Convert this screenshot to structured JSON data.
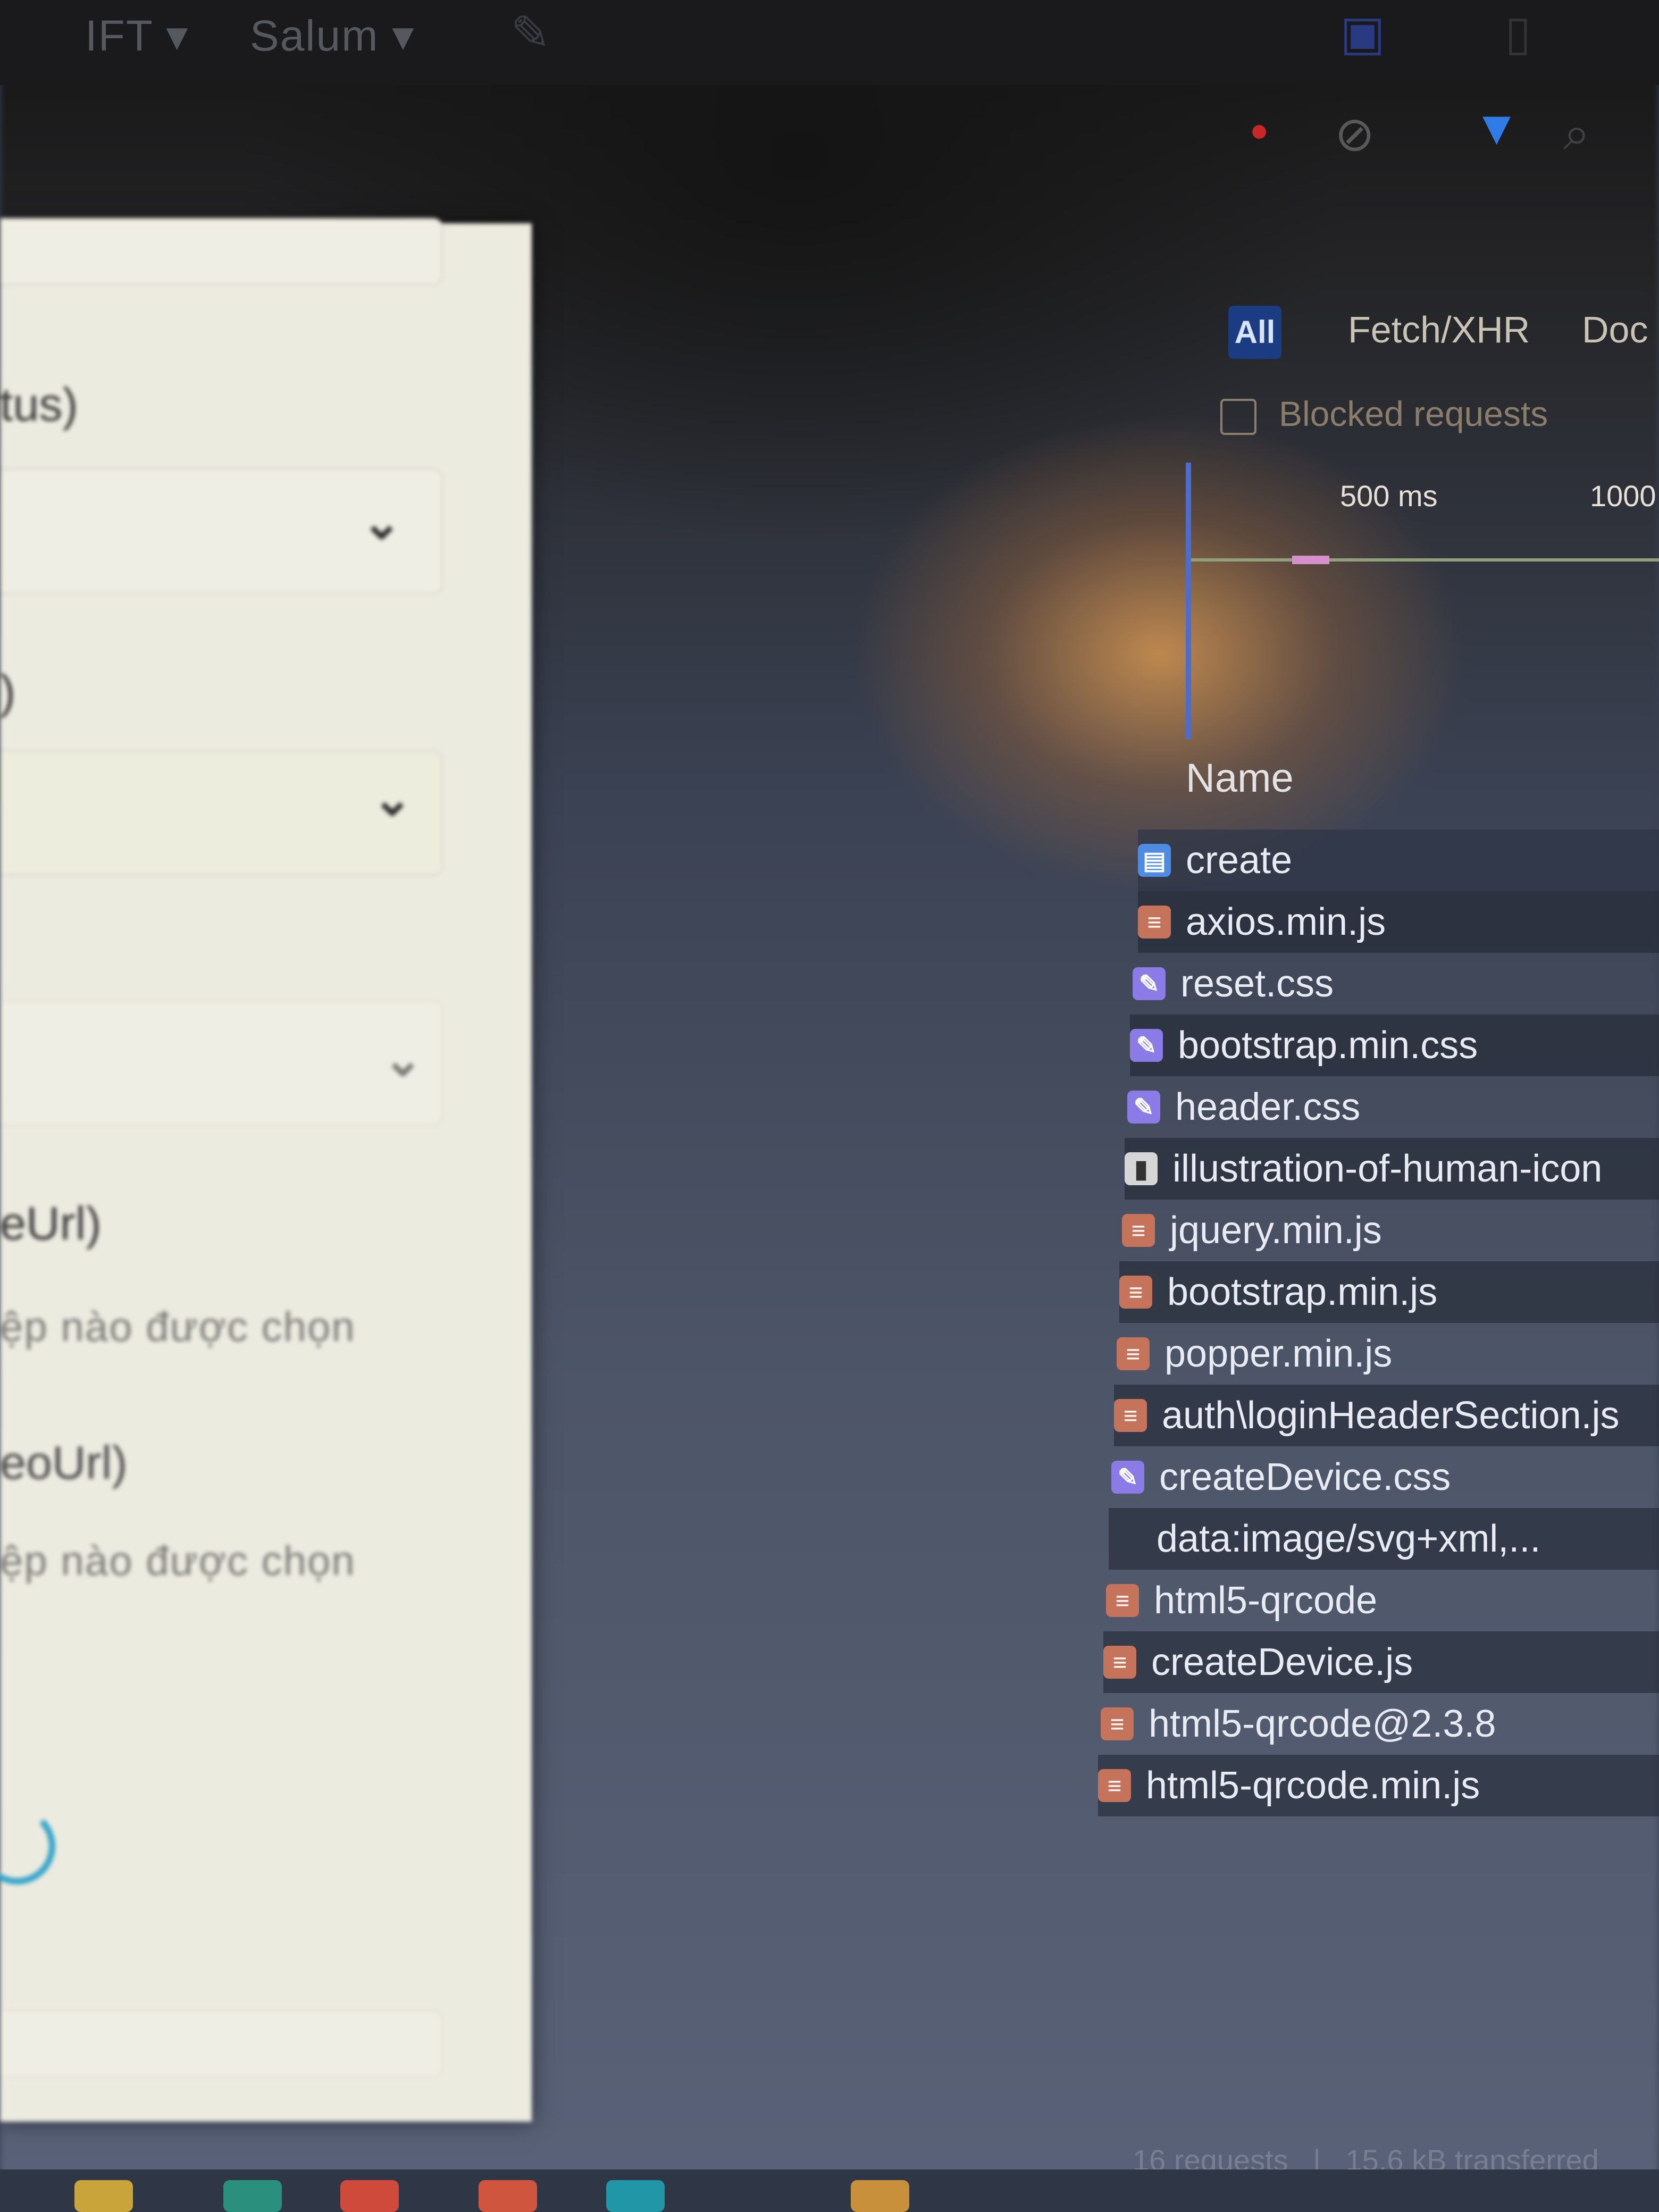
{
  "top_bar": {
    "item_1": "IFT ▾",
    "item_2": "Salum ▾"
  },
  "form_panel": {
    "label_status": "tus)",
    "label_paren": ")",
    "label_imageurl": "eUrl)",
    "hint_1": "ệp nào được chọn",
    "label_videourl": "eoUrl)",
    "hint_2": "ệp nào được chọn"
  },
  "devtools": {
    "filter_all": "All",
    "filter_fetch": "Fetch/XHR",
    "filter_doc": "Doc",
    "blocked_label": "Blocked requests",
    "tick_1": "500 ms",
    "tick_2": "1000",
    "name_header": "Name",
    "requests": [
      {
        "name": "create",
        "type": "doc"
      },
      {
        "name": "axios.min.js",
        "type": "js"
      },
      {
        "name": "reset.css",
        "type": "css"
      },
      {
        "name": "bootstrap.min.css",
        "type": "css"
      },
      {
        "name": "header.css",
        "type": "css"
      },
      {
        "name": "illustration-of-human-icon",
        "type": "img"
      },
      {
        "name": "jquery.min.js",
        "type": "js"
      },
      {
        "name": "bootstrap.min.js",
        "type": "js"
      },
      {
        "name": "popper.min.js",
        "type": "js"
      },
      {
        "name": "auth\\loginHeaderSection.js",
        "type": "js"
      },
      {
        "name": "createDevice.css",
        "type": "css"
      },
      {
        "name": "data:image/svg+xml,...",
        "type": "none"
      },
      {
        "name": "html5-qrcode",
        "type": "js"
      },
      {
        "name": "createDevice.js",
        "type": "js"
      },
      {
        "name": "html5-qrcode@2.3.8",
        "type": "js"
      },
      {
        "name": "html5-qrcode.min.js",
        "type": "js"
      }
    ],
    "status_requests": "16 requests",
    "status_transferred": "15.6 kB transferred"
  },
  "colors": {
    "panel_bg": "#ecebe0",
    "devtools_bg": "#3b4253",
    "accent_blue": "#4d6ccf",
    "js_badge": "#c6735b",
    "css_badge": "#8a7be6"
  }
}
